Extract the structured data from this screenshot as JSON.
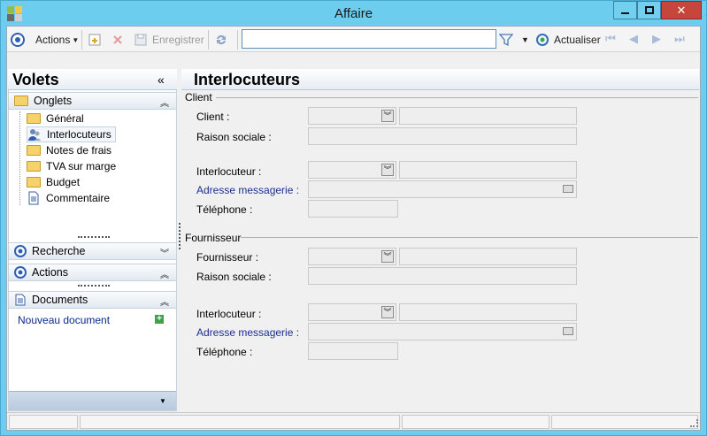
{
  "window": {
    "title": "Affaire"
  },
  "toolbar": {
    "actions_label": "Actions",
    "save_label": "Enregistrer",
    "search_value": "",
    "refresh_label": "Actualiser"
  },
  "left": {
    "title": "Volets",
    "onglets": {
      "label": "Onglets",
      "items": [
        {
          "label": "Général",
          "icon": "folder-icon"
        },
        {
          "label": "Interlocuteurs",
          "icon": "contacts-icon"
        },
        {
          "label": "Notes de frais",
          "icon": "folder-icon"
        },
        {
          "label": "TVA sur marge",
          "icon": "folder-icon"
        },
        {
          "label": "Budget",
          "icon": "folder-icon"
        },
        {
          "label": "Commentaire",
          "icon": "document-icon"
        }
      ]
    },
    "recherche": {
      "label": "Recherche"
    },
    "actions": {
      "label": "Actions"
    },
    "documents": {
      "label": "Documents",
      "new_doc": "Nouveau document"
    }
  },
  "main": {
    "title": "Interlocuteurs",
    "client": {
      "group": "Client",
      "client_label": "Client :",
      "raison_label": "Raison sociale :",
      "interlocuteur_label": "Interlocuteur :",
      "email_label": "Adresse messagerie :",
      "phone_label": "Téléphone :"
    },
    "fournisseur": {
      "group": "Fournisseur",
      "fournisseur_label": "Fournisseur :",
      "raison_label": "Raison sociale :",
      "interlocuteur_label": "Interlocuteur :",
      "email_label": "Adresse messagerie :",
      "phone_label": "Téléphone :"
    }
  },
  "colors": {
    "titlebar": "#6ccdef",
    "link": "#0a2a8c",
    "close": "#c7463b"
  }
}
